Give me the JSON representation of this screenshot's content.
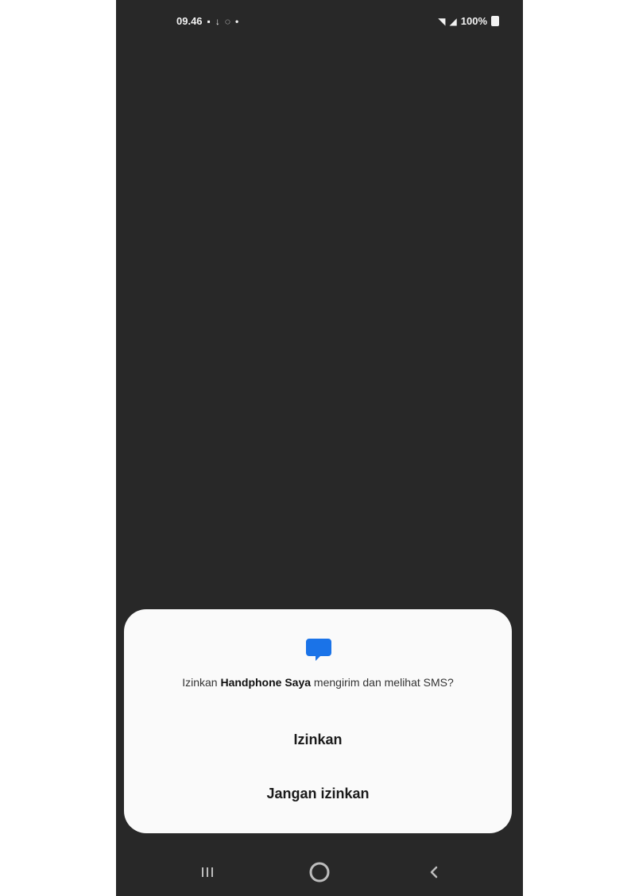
{
  "status_bar": {
    "time": "09.46",
    "left_icons": [
      "notification-icon",
      "download-icon",
      "location-icon",
      "dot-icon"
    ],
    "battery": "100%",
    "right_icons": [
      "wifi-icon",
      "signal-icon",
      "battery-icon"
    ]
  },
  "dialog": {
    "icon": "message-bubble-icon",
    "accent_color": "#1a73e8",
    "message_prefix": "Izinkan ",
    "app_name": "Handphone Saya",
    "message_suffix": " mengirim dan melihat SMS?",
    "allow_label": "Izinkan",
    "deny_label": "Jangan izinkan"
  },
  "nav_bar": {
    "recents": "recents-icon",
    "home": "home-icon",
    "back": "back-icon"
  }
}
